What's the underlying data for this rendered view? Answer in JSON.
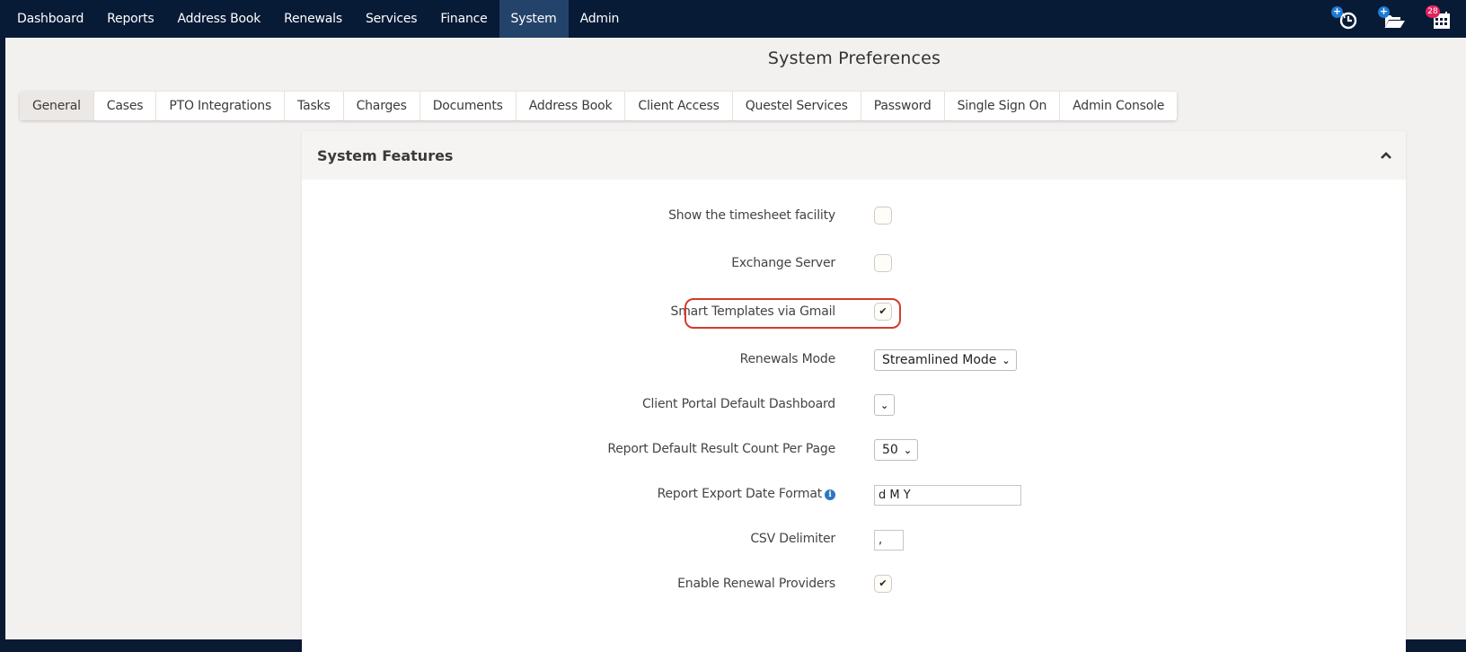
{
  "topnav": {
    "items": [
      "Dashboard",
      "Reports",
      "Address Book",
      "Renewals",
      "Services",
      "Finance",
      "System",
      "Admin"
    ],
    "active": "System",
    "icons": [
      {
        "name": "timesheet-add-icon",
        "badge": "+"
      },
      {
        "name": "folder-add-icon",
        "badge": "+"
      },
      {
        "name": "calendar-icon",
        "badge": "28"
      }
    ]
  },
  "page": {
    "title": "System Preferences"
  },
  "tabs": {
    "items": [
      "General",
      "Cases",
      "PTO Integrations",
      "Tasks",
      "Charges",
      "Documents",
      "Address Book",
      "Client Access",
      "Questel Services",
      "Password",
      "Single Sign On",
      "Admin Console"
    ],
    "active": "General"
  },
  "panel": {
    "title": "System Features",
    "fields": {
      "timesheet": {
        "label": "Show the timesheet facility",
        "checked": false
      },
      "exchange": {
        "label": "Exchange Server",
        "checked": false
      },
      "smart_templates": {
        "label": "Smart Templates via Gmail",
        "checked": true
      },
      "renewals_mode": {
        "label": "Renewals Mode",
        "value": "Streamlined Mode"
      },
      "client_portal": {
        "label": "Client Portal Default Dashboard",
        "value": ""
      },
      "report_count": {
        "label": "Report Default Result Count Per Page",
        "value": "50"
      },
      "export_date": {
        "label": "Report Export Date Format",
        "value": "d M Y"
      },
      "csv_delimiter": {
        "label": "CSV Delimiter",
        "value": ","
      },
      "renewal_providers": {
        "label": "Enable Renewal Providers",
        "checked": true
      }
    },
    "check_glyph": "✔"
  },
  "colors": {
    "topnav_bg": "#071a36",
    "active_nav_bg": "#24436b",
    "page_bg": "#f3f1ef",
    "highlight": "#d23c2c",
    "badge_blue": "#1e7ad6",
    "badge_red": "#e0245e"
  }
}
